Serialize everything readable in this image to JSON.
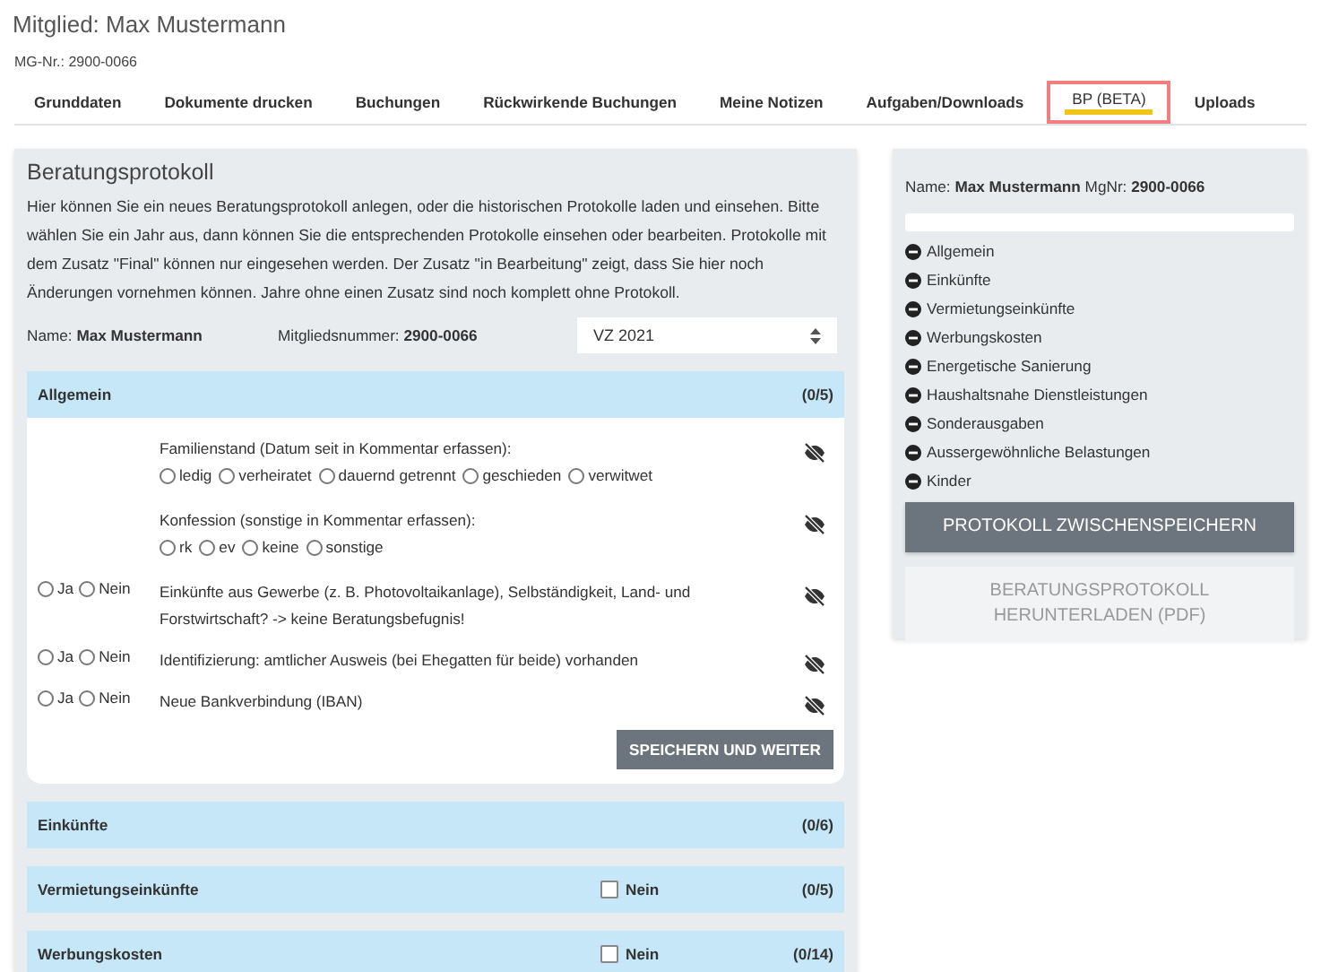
{
  "header": {
    "title": "Mitglied: Max Mustermann",
    "member_no": "MG-Nr.: 2900-0066"
  },
  "tabs": [
    {
      "label": "Grunddaten",
      "selected": false
    },
    {
      "label": "Dokumente drucken",
      "selected": false
    },
    {
      "label": "Buchungen",
      "selected": false
    },
    {
      "label": "Rückwirkende Buchungen",
      "selected": false
    },
    {
      "label": "Meine Notizen",
      "selected": false
    },
    {
      "label": "Aufgaben/Downloads",
      "selected": false
    },
    {
      "label": "BP (BETA)",
      "selected": true
    },
    {
      "label": "Uploads",
      "selected": false
    }
  ],
  "protocol": {
    "title": "Beratungsprotokoll",
    "intro": "Hier können Sie ein neues Beratungsprotokoll anlegen, oder die historischen Protokolle laden und einsehen. Bitte wählen Sie ein Jahr aus, dann können Sie die entsprechenden Protokolle einsehen oder bearbeiten. Protokolle mit dem Zusatz \"Final\" können nur eingesehen werden. Der Zusatz \"in Bearbeitung\" zeigt, dass Sie hier noch Änderungen vornehmen können. Jahre ohne einen Zusatz sind noch komplett ohne Protokoll.",
    "name": "Name: **Max Mustermann**",
    "number": "Mitgliedsnummer: **2900-0066**",
    "year": "VZ 2021",
    "sections": [
      {
        "title": "Allgemein",
        "count": "(0/5)",
        "items": [
          {
            "kind": "choice",
            "question": "Familienstand (Datum seit in Kommentar erfassen):",
            "options": [
              {
                "label": "ledig",
                "selected": false
              },
              {
                "label": "verheiratet",
                "selected": false
              },
              {
                "label": "dauernd getrennt",
                "selected": false
              },
              {
                "label": "geschieden",
                "selected": false
              },
              {
                "label": "verwitwet",
                "selected": false
              }
            ]
          },
          {
            "kind": "choice",
            "question": "Konfession (sonstige in Kommentar erfassen):",
            "options": [
              {
                "label": "rk",
                "selected": false
              },
              {
                "label": "ev",
                "selected": false
              },
              {
                "label": "keine",
                "selected": false
              },
              {
                "label": "sonstige",
                "selected": false
              }
            ]
          },
          {
            "kind": "yesno",
            "question": "Einkünfte aus Gewerbe (z. B. Photovoltaikanlage), Selbständigkeit, Land- und Forstwirtschaft? -> keine Beratungsbefugnis!",
            "options": [
              {
                "label": "Ja",
                "selected": false
              },
              {
                "label": "Nein",
                "selected": false
              }
            ]
          },
          {
            "kind": "yesno",
            "question": "Identifizierung: amtlicher Ausweis (bei Ehegatten für beide) vorhanden",
            "options": [
              {
                "label": "Ja",
                "selected": false
              },
              {
                "label": "Nein",
                "selected": false
              }
            ]
          },
          {
            "kind": "yesno",
            "question": "Neue Bankverbindung (IBAN)",
            "options": [
              {
                "label": "Ja",
                "selected": false
              },
              {
                "label": "Nein",
                "selected": false
              }
            ]
          }
        ],
        "button": "SPEICHERN UND WEITER"
      },
      {
        "title": "Einkünfte",
        "count": "(0/6)"
      },
      {
        "title": "Vermietungseinkünfte",
        "count": "(0/5)",
        "none_box": {
          "label": "Nein",
          "checked": false
        }
      },
      {
        "title": "Werbungskosten",
        "count": "(0/14)",
        "none_box": {
          "label": "Nein",
          "checked": false
        }
      }
    ]
  },
  "sidebar": {
    "info": "Name: **Max Mustermann** MgNr: **2900-0066**",
    "progress": {
      "level": 0
    },
    "items": [
      "Allgemein",
      "Einkünfte",
      "Vermietungseinkünfte",
      "Werbungskosten",
      "Energetische Sanierung",
      "Haushaltsnahe Dienstleistungen",
      "Sonderausgaben",
      "Aussergewöhnliche Belastungen",
      "Kinder"
    ],
    "buttons": [
      {
        "label": "PROTOKOLL ZWISCHENSPEICHERN",
        "disabled": false
      },
      {
        "label": "BERATUNGSPROTOKOLL HERUNTERLADEN (PDF)",
        "disabled": true
      }
    ]
  }
}
